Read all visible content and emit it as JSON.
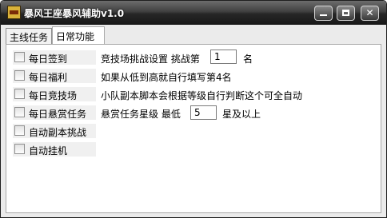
{
  "window": {
    "title": "暴风王座暴风辅助v1.0",
    "icon": "app-logo-icon"
  },
  "title_buttons": {
    "minimize": "minimize-icon",
    "maximize": "maximize-icon",
    "close_label": "✕"
  },
  "tabs": [
    {
      "label": "主线任务",
      "active": false
    },
    {
      "label": "日常功能",
      "active": true
    }
  ],
  "checkboxes": [
    {
      "label": "每日签到",
      "checked": false
    },
    {
      "label": "每日福利",
      "checked": false
    },
    {
      "label": "每日竞技场",
      "checked": false
    },
    {
      "label": "每日悬赏任务",
      "checked": false
    },
    {
      "label": "自动副本挑战",
      "checked": false
    },
    {
      "label": "自动挂机",
      "checked": false
    }
  ],
  "arena": {
    "prefix": "竞技场挑战设置  挑战第",
    "value": "1",
    "suffix": "名"
  },
  "welfare_hint": "如果从低到高就自行填写第4名",
  "arena_hint": "小队副本脚本会根据等级自行判断这个可全自动",
  "bounty": {
    "prefix": "悬赏任务星级  最低",
    "value": "5",
    "suffix": "星及以上"
  }
}
